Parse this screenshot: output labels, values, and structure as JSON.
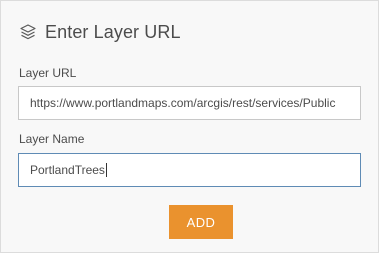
{
  "header": {
    "icon": "layers-icon",
    "title": "Enter Layer URL"
  },
  "form": {
    "url_label": "Layer URL",
    "url_value": "https://www.portlandmaps.com/arcgis/rest/services/Public",
    "name_label": "Layer Name",
    "name_value": "PortlandTrees",
    "add_button_label": "ADD"
  },
  "colors": {
    "accent": "#ea922e",
    "focus_border": "#5f8bb5",
    "text": "#4c4c4c",
    "panel_bg": "#f8f8f8"
  }
}
